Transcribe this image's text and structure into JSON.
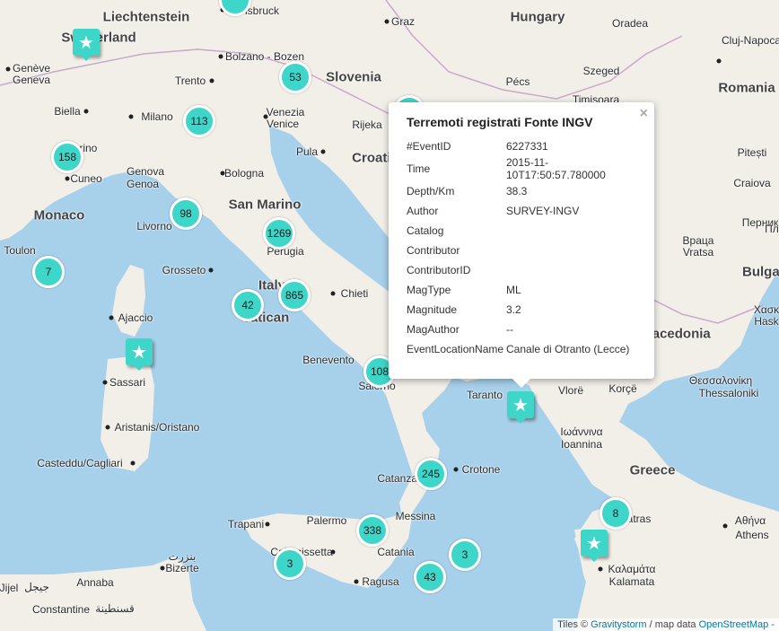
{
  "countries": [
    "Liechtenstein",
    "Switzerland",
    "Hungary",
    "Slovenia",
    "Romania",
    "Monaco",
    "San Marino",
    "Italy",
    "Vatican",
    "Croatia",
    "Macedonia",
    "Bulgaria",
    "Greece"
  ],
  "cities": [
    "Innsbruck",
    "Graz",
    "Oradea",
    "Cluj-Napoca",
    "Genève",
    "Geneva",
    "Bolzano - Bozen",
    "Szeged",
    "Pécs",
    "Timișoara",
    "Trento",
    "Biella",
    "Milano",
    "Venezia",
    "Venice",
    "Rijeka",
    "Torino",
    "Pitești",
    "Cuneo",
    "Genova",
    "Genoa",
    "Pula",
    "Bologna",
    "Craiova",
    "Livorno",
    "Перник",
    "Враца",
    "Vratsa",
    "Пл",
    "Toulon",
    "Grosseto",
    "Perugia",
    "Chieti",
    "Ajaccio",
    "Χασκ",
    "Hask",
    "Benevento",
    "Salerno",
    "Θεσσαλονίκη",
    "Thessaloniki",
    "Sassari",
    "Taranto",
    "Vlorë",
    "Korçë",
    "Ιωάννινα",
    "Ioannina",
    "Aristanis/Oristano",
    "Catanzaro",
    "Crotone",
    "Casteddu/Cagliari",
    "Messina",
    "Αθήνα",
    "Athens",
    "Trapani",
    "Palermo",
    "Caltanissetta",
    "Catania",
    "Καλαμάτα",
    "Kalamata",
    "Bizerte",
    "بنزرت",
    "Annaba",
    "Ragusa",
    "Jijel",
    "جيجل",
    "Constantine",
    "قسنطينة",
    "Patras"
  ],
  "clusters": [
    "53",
    "113",
    "158",
    "98",
    "1269",
    "42",
    "865",
    "108",
    "245",
    "338",
    "3",
    "3",
    "43",
    "8"
  ],
  "pins": [
    "star-icon",
    "star-icon",
    "star-icon",
    "star-icon"
  ],
  "popup": {
    "title": "Terremoti registrati Fonte INGV",
    "close": "×",
    "rows": [
      {
        "k": "#EventID",
        "v": "6227331"
      },
      {
        "k": "Time",
        "v": "2015-11-10T17:50:57.780000"
      },
      {
        "k": "Depth/Km",
        "v": "38.3"
      },
      {
        "k": "Author",
        "v": "SURVEY-INGV"
      },
      {
        "k": "Catalog",
        "v": ""
      },
      {
        "k": "Contributor",
        "v": ""
      },
      {
        "k": "ContributorID",
        "v": ""
      },
      {
        "k": "MagType",
        "v": "ML"
      },
      {
        "k": "Magnitude",
        "v": "3.2"
      },
      {
        "k": "MagAuthor",
        "v": "--"
      },
      {
        "k": "EventLocationName",
        "v": "Canale di Otranto (Lecce)"
      }
    ]
  },
  "attribution": {
    "tiles": "Tiles ©",
    "provider": "Gravitystorm",
    "sep": "/ map data",
    "osm": "OpenStreetMap -"
  },
  "colors": {
    "land": "#f2efe9",
    "sea": "#a7d0ea",
    "cluster": "#3ed6c9",
    "border": "#c9a9c9"
  }
}
